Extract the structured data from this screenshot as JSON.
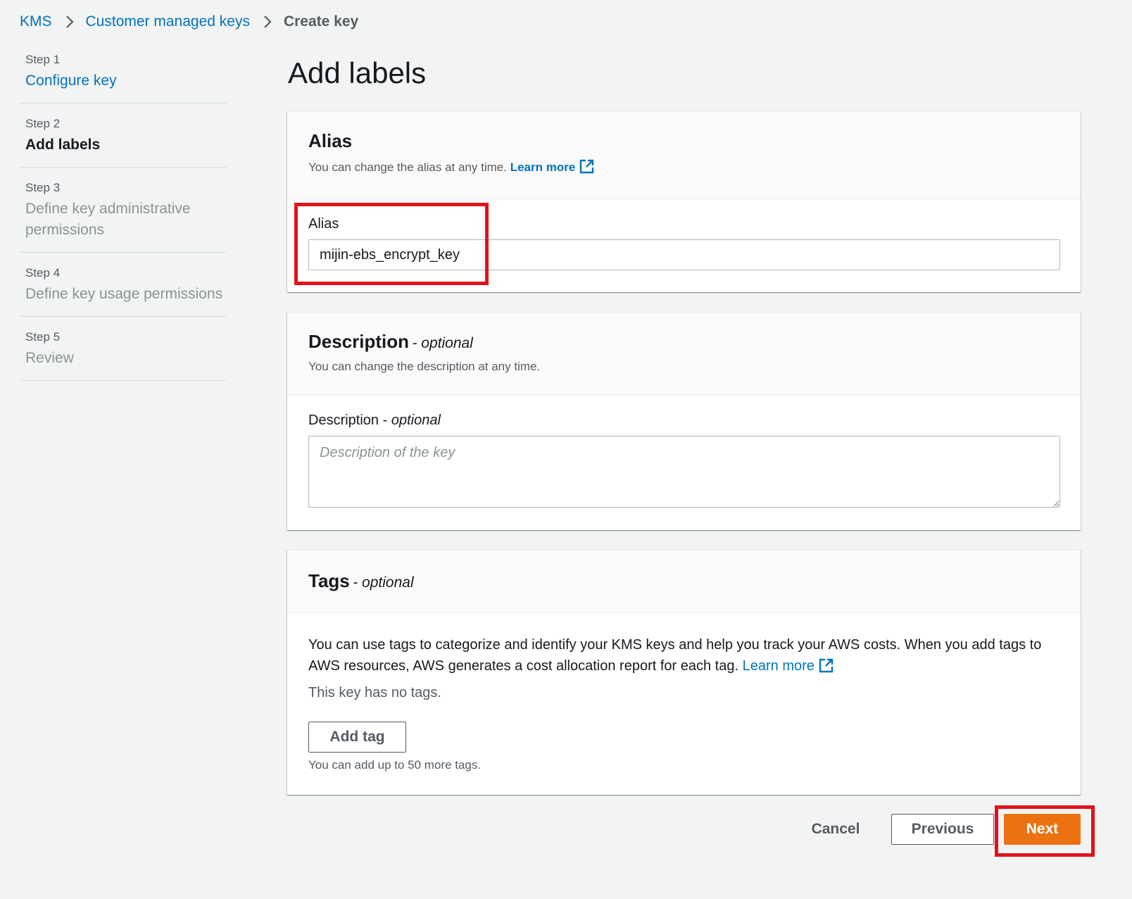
{
  "breadcrumb": {
    "items": [
      {
        "label": "KMS"
      },
      {
        "label": "Customer managed keys"
      },
      {
        "label": "Create key"
      }
    ]
  },
  "steps": [
    {
      "num": "Step 1",
      "title": "Configure key",
      "state": "link"
    },
    {
      "num": "Step 2",
      "title": "Add labels",
      "state": "current"
    },
    {
      "num": "Step 3",
      "title": "Define key administrative permissions",
      "state": "disabled"
    },
    {
      "num": "Step 4",
      "title": "Define key usage permissions",
      "state": "disabled"
    },
    {
      "num": "Step 5",
      "title": "Review",
      "state": "disabled"
    }
  ],
  "page": {
    "title": "Add labels"
  },
  "alias_section": {
    "heading": "Alias",
    "description": "You can change the alias at any time.",
    "learn_more": "Learn more",
    "field_label": "Alias",
    "field_value": "mijin-ebs_encrypt_key"
  },
  "description_section": {
    "heading": "Description",
    "optional": "- optional",
    "description": "You can change the description at any time.",
    "field_label": "Description",
    "field_optional": "optional",
    "placeholder": "Description of the key"
  },
  "tags_section": {
    "heading": "Tags",
    "optional": "- optional",
    "info": "You can use tags to categorize and identify your KMS keys and help you track your AWS costs. When you add tags to AWS resources, AWS generates a cost allocation report for each tag.",
    "learn_more": "Learn more",
    "no_tags": "This key has no tags.",
    "add_tag": "Add tag",
    "limit_note": "You can add up to 50 more tags."
  },
  "footer": {
    "cancel": "Cancel",
    "previous": "Previous",
    "next": "Next"
  },
  "colors": {
    "link": "#0073bb",
    "primary": "#ec7211",
    "highlight": "#e0121d",
    "background": "#f2f3f3"
  }
}
